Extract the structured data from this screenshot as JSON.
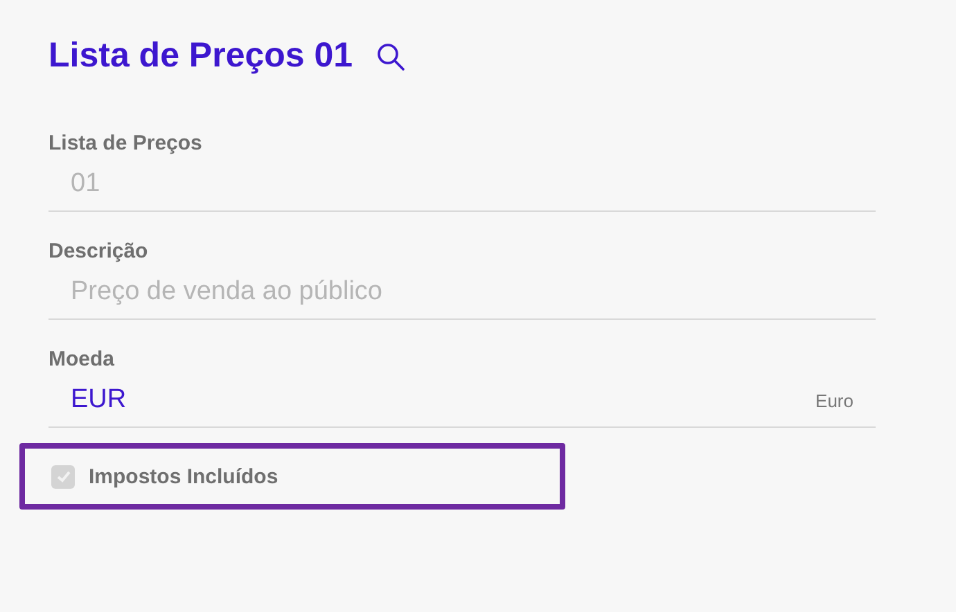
{
  "title": "Lista de Preços 01",
  "fields": [
    {
      "label": "Lista de Preços",
      "value": "01",
      "disabled": true
    },
    {
      "label": "Descrição",
      "value": "Preço de venda ao público",
      "disabled": true
    },
    {
      "label": "Moeda",
      "value": "EUR",
      "suffix": "Euro",
      "disabled": false
    }
  ],
  "checkbox": {
    "label": "Impostos Incluídos",
    "checked": true,
    "disabled": true,
    "highlighted": true
  }
}
